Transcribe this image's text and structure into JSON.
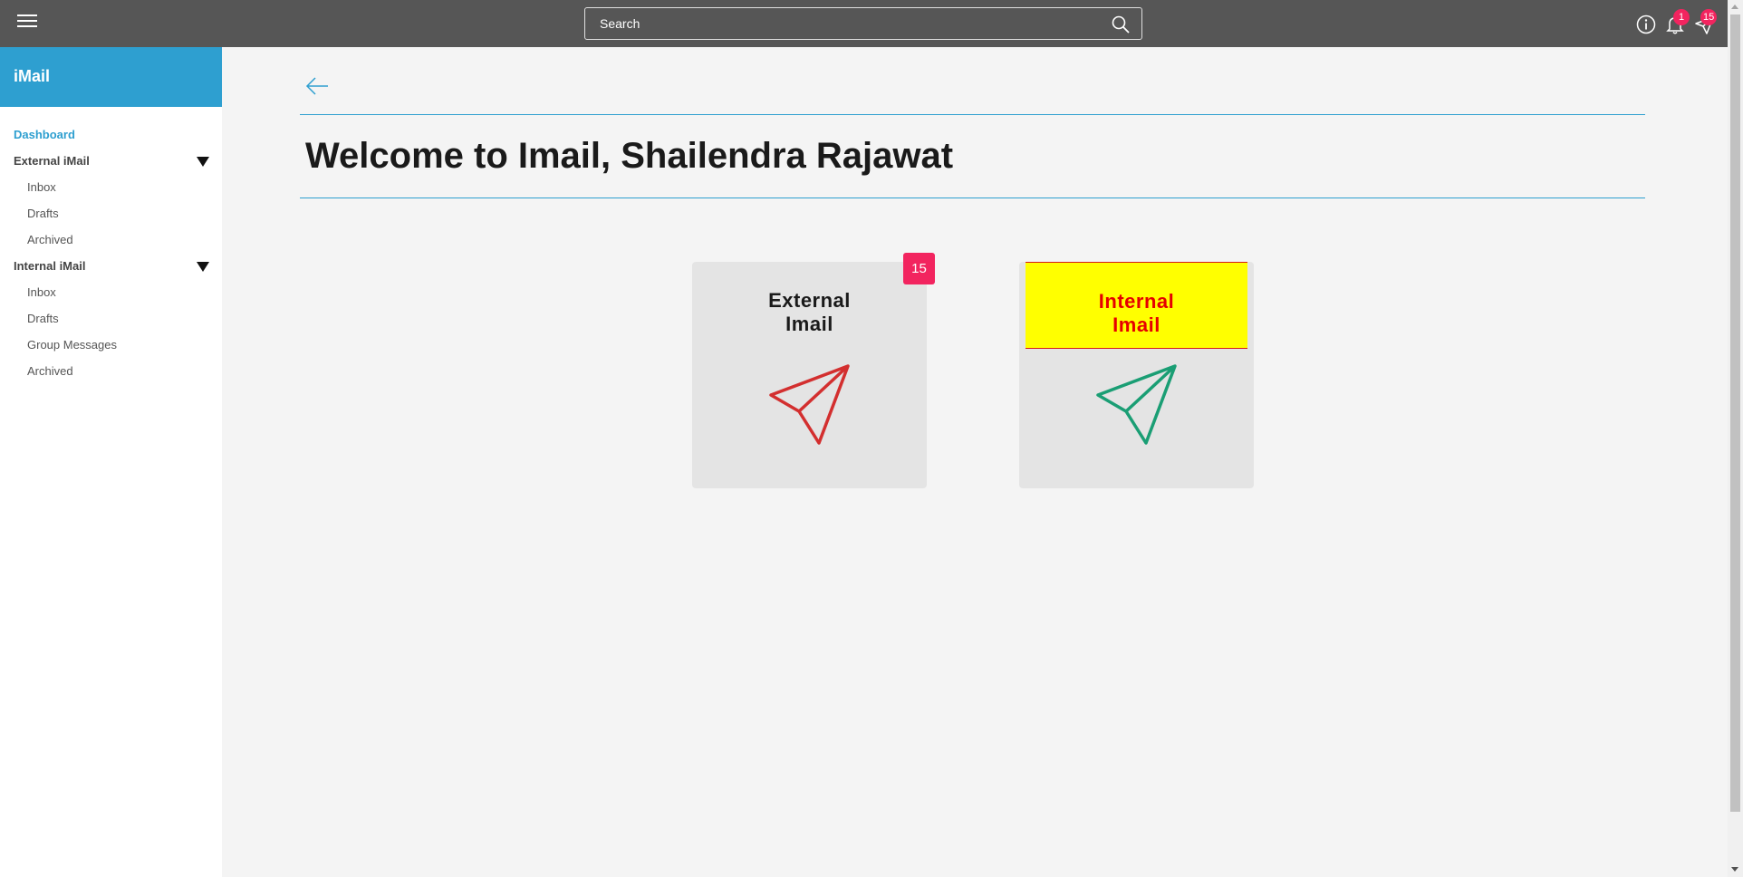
{
  "topbar": {
    "search_placeholder": "Search",
    "notifications_count": "1",
    "messages_count": "15"
  },
  "sidebar": {
    "title": "iMail",
    "items": [
      {
        "label": "Dashboard",
        "level": "top",
        "active": true
      },
      {
        "label": "External iMail",
        "level": "section",
        "expandable": true
      },
      {
        "label": "Inbox",
        "level": "sub"
      },
      {
        "label": "Drafts",
        "level": "sub"
      },
      {
        "label": "Archived",
        "level": "sub"
      },
      {
        "label": "Internal iMail",
        "level": "section",
        "expandable": true
      },
      {
        "label": "Inbox",
        "level": "sub"
      },
      {
        "label": "Drafts",
        "level": "sub"
      },
      {
        "label": "Group Messages",
        "level": "sub"
      },
      {
        "label": "Archived",
        "level": "sub"
      }
    ]
  },
  "main": {
    "welcome": "Welcome to Imail, Shailendra Rajawat",
    "cards": [
      {
        "line1": "External",
        "line2": "Imail",
        "badge": "15",
        "icon": "paper-plane-icon",
        "icon_color": "#d32f2f"
      },
      {
        "line1": "Internal",
        "line2": "Imail",
        "icon": "paper-plane-icon",
        "icon_color": "#1a9e74",
        "highlight_bg": "#ffff00",
        "title_color": "#e60000"
      }
    ]
  },
  "colors": {
    "topbar": "#565656",
    "accent": "#2e9fd0",
    "badge": "#f2245f"
  }
}
